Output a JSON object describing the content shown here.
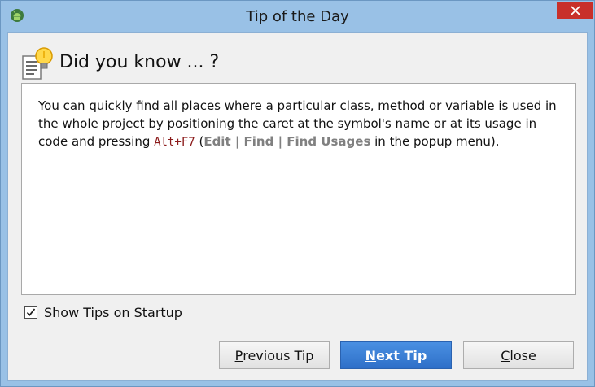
{
  "window": {
    "title": "Tip of the Day",
    "app_icon": "android-icon",
    "close_icon": "close-icon"
  },
  "header": {
    "icon": "lightbulb-icon",
    "title": "Did you know ... ?"
  },
  "tip": {
    "part1": "You can quickly find all places where a particular class, method or variable is used in the whole project by positioning the caret at the symbol's name or at its usage in code and pressing ",
    "shortcut": "Alt+F7",
    "open_paren": " (",
    "menu_path": "Edit | Find | Find Usages",
    "part2": " in the popup menu)."
  },
  "startup_checkbox": {
    "label": "Show Tips on Startup",
    "checked": true
  },
  "buttons": {
    "previous": {
      "mnemonic": "P",
      "rest": "revious Tip"
    },
    "next": {
      "mnemonic": "N",
      "rest": "ext Tip"
    },
    "close": {
      "mnemonic": "C",
      "rest": "lose"
    }
  },
  "colors": {
    "titlebar": "#99c1e6",
    "close_button": "#c8302a",
    "primary_button": "#3a7fd8",
    "shortcut_text": "#8b1a1a",
    "menu_path_text": "#808080"
  }
}
